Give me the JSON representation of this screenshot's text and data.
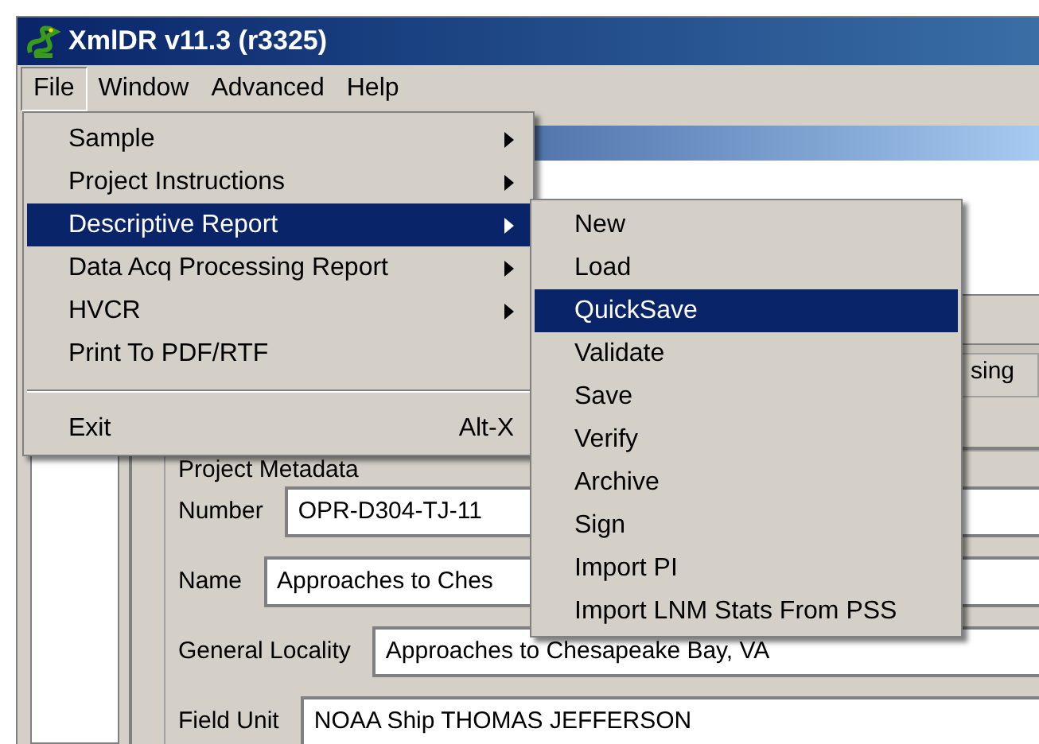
{
  "window": {
    "title": "XmlDR v11.3 (r3325)"
  },
  "menu_bar": [
    {
      "label": "File",
      "selected": true
    },
    {
      "label": "Window",
      "selected": false
    },
    {
      "label": "Advanced",
      "selected": false
    },
    {
      "label": "Help",
      "selected": false
    }
  ],
  "file_menu": [
    {
      "kind": "submenu",
      "label": "Sample",
      "selected": false
    },
    {
      "kind": "submenu",
      "label": "Project Instructions",
      "selected": false
    },
    {
      "kind": "submenu",
      "label": "Descriptive Report",
      "selected": true
    },
    {
      "kind": "submenu",
      "label": "Data Acq Processing Report",
      "selected": false
    },
    {
      "kind": "submenu",
      "label": "HVCR",
      "selected": false
    },
    {
      "kind": "command",
      "label": "Print To PDF/RTF",
      "selected": false
    },
    {
      "kind": "separator"
    },
    {
      "kind": "command",
      "label": "Exit",
      "shortcut": "Alt-X",
      "selected": false
    }
  ],
  "descriptive_report_menu": [
    {
      "label": "New",
      "selected": false
    },
    {
      "label": "Load",
      "selected": false
    },
    {
      "label": "QuickSave",
      "selected": true
    },
    {
      "label": "Validate",
      "selected": false
    },
    {
      "label": "Save",
      "selected": false
    },
    {
      "label": "Verify",
      "selected": false
    },
    {
      "label": "Archive",
      "selected": false
    },
    {
      "label": "Sign",
      "selected": false
    },
    {
      "label": "Import PI",
      "selected": false
    },
    {
      "label": "Import LNM Stats From PSS",
      "selected": false
    }
  ],
  "tab": {
    "label": "sing"
  },
  "project_metadata": {
    "title": "Project Metadata",
    "fields": [
      {
        "label": "Number",
        "value": "OPR-D304-TJ-11"
      },
      {
        "label": "Name",
        "value": "Approaches to Ches"
      },
      {
        "label": "General Locality",
        "value": "Approaches to Chesapeake Bay, VA"
      },
      {
        "label": "Field Unit",
        "value": "NOAA Ship THOMAS JEFFERSON"
      }
    ]
  }
}
